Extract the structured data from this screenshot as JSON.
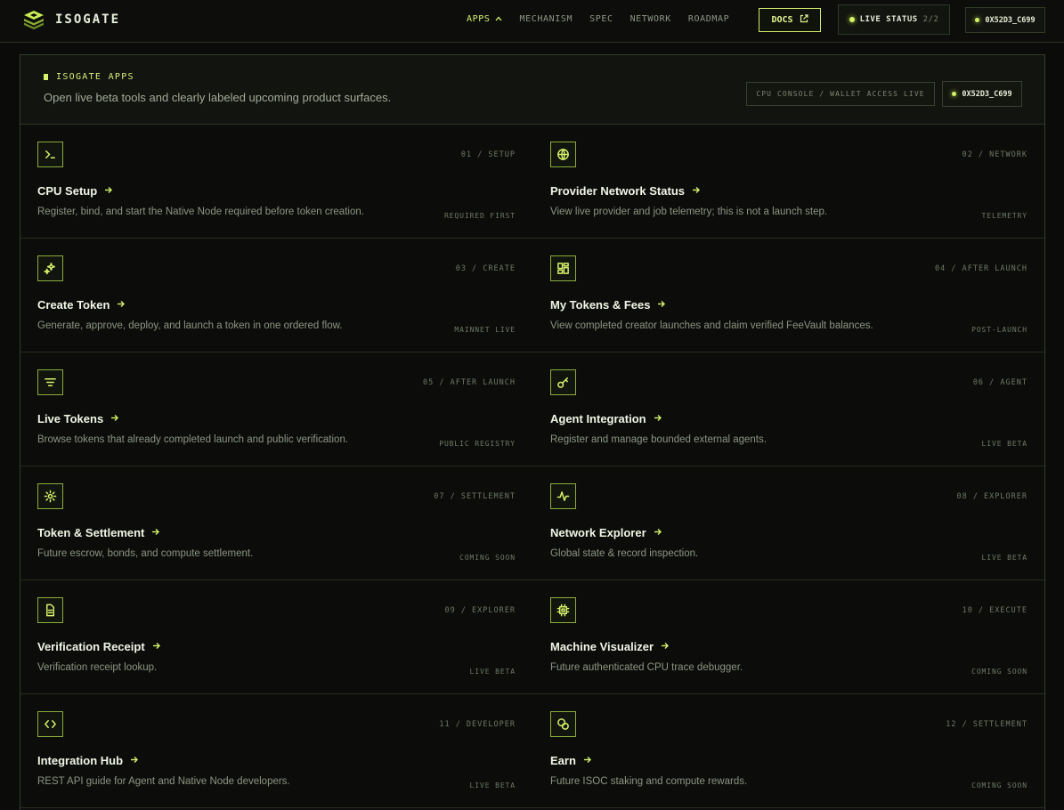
{
  "brand": {
    "name": "ISOGATE",
    "logo_icon": "stack-layers-icon"
  },
  "nav": {
    "items": [
      {
        "label": "APPS",
        "active": true,
        "caret": "^"
      },
      {
        "label": "MECHANISM"
      },
      {
        "label": "SPEC"
      },
      {
        "label": "NETWORK"
      },
      {
        "label": "ROADMAP"
      }
    ],
    "docs_label": "DOCS",
    "live_status_label": "LIVE STATUS",
    "live_status_count": "2/2",
    "wallet": "0X52D3_C699"
  },
  "panel": {
    "eyebrow": "ISOGATE APPS",
    "tagline": "Open live beta tools and clearly labeled upcoming product surfaces.",
    "console_pill": "CPU CONSOLE / WALLET ACCESS LIVE",
    "wallet": "0X52D3_C699"
  },
  "apps": [
    {
      "icon": "terminal-icon",
      "tag": "01 / SETUP",
      "title": "CPU Setup",
      "desc": "Register, bind, and start the Native Node required before token creation.",
      "status": "REQUIRED FIRST"
    },
    {
      "icon": "globe-icon",
      "tag": "02 / NETWORK",
      "title": "Provider Network Status",
      "desc": "View live provider and job telemetry; this is not a launch step.",
      "status": "TELEMETRY"
    },
    {
      "icon": "sparkles-icon",
      "tag": "03 / CREATE",
      "title": "Create Token",
      "desc": "Generate, approve, deploy, and launch a token in one ordered flow.",
      "status": "MAINNET LIVE"
    },
    {
      "icon": "dashboard-icon",
      "tag": "04 / AFTER LAUNCH",
      "title": "My Tokens & Fees",
      "desc": "View completed creator launches and claim verified FeeVault balances.",
      "status": "POST-LAUNCH"
    },
    {
      "icon": "filter-list-icon",
      "tag": "05 / AFTER LAUNCH",
      "title": "Live Tokens",
      "desc": "Browse tokens that already completed launch and public verification.",
      "status": "PUBLIC REGISTRY"
    },
    {
      "icon": "key-icon",
      "tag": "06 / AGENT",
      "title": "Agent Integration",
      "desc": "Register and manage bounded external agents.",
      "status": "LIVE BETA"
    },
    {
      "icon": "gear-icon",
      "tag": "07 / SETTLEMENT",
      "title": "Token & Settlement",
      "desc": "Future escrow, bonds, and compute settlement.",
      "status": "COMING SOON"
    },
    {
      "icon": "activity-icon",
      "tag": "08 / EXPLORER",
      "title": "Network Explorer",
      "desc": "Global state & record inspection.",
      "status": "LIVE BETA"
    },
    {
      "icon": "document-icon",
      "tag": "09 / EXPLORER",
      "title": "Verification Receipt",
      "desc": "Verification receipt lookup.",
      "status": "LIVE BETA"
    },
    {
      "icon": "cpu-chip-icon",
      "tag": "10 / EXECUTE",
      "title": "Machine Visualizer",
      "desc": "Future authenticated CPU trace debugger.",
      "status": "COMING SOON"
    },
    {
      "icon": "code-icon",
      "tag": "11 / DEVELOPER",
      "title": "Integration Hub",
      "desc": "REST API guide for Agent and Native Node developers.",
      "status": "LIVE BETA"
    },
    {
      "icon": "coins-icon",
      "tag": "12 / SETTLEMENT",
      "title": "Earn",
      "desc": "Future ISOC staking and compute rewards.",
      "status": "COMING SOON"
    }
  ],
  "colors": {
    "accent": "#d6f26a",
    "background": "#0b0c09",
    "border": "#333d27",
    "muted": "#8c9482"
  }
}
